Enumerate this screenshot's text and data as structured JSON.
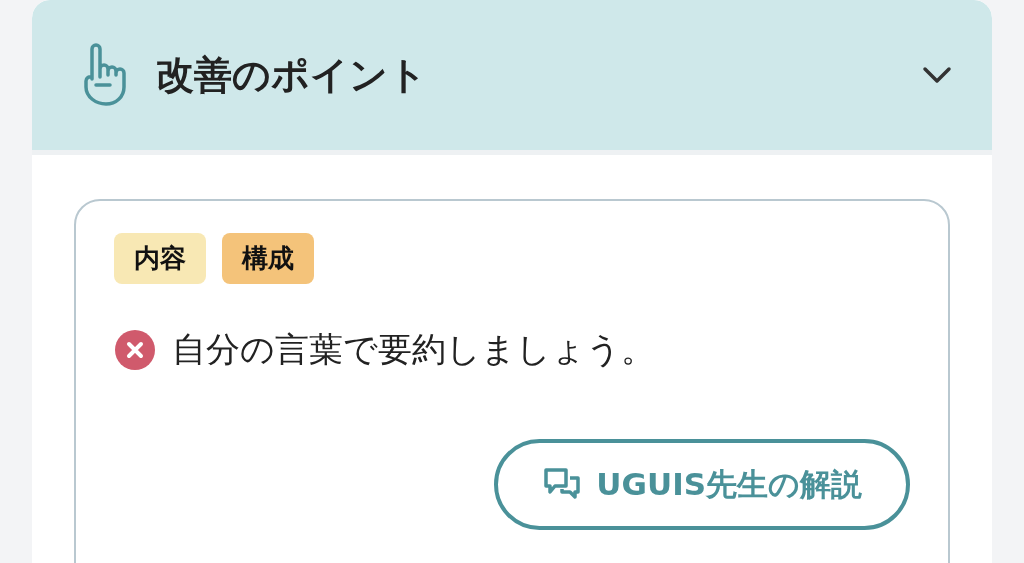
{
  "section": {
    "title": "改善のポイント"
  },
  "points": [
    {
      "tags": [
        {
          "label": "内容",
          "color": "#f8e8b4"
        },
        {
          "label": "構成",
          "color": "#f4c37a"
        }
      ],
      "kind": "error",
      "message": "自分の言葉で要約しましょう。",
      "action": "UGUIS先生の解説"
    }
  ]
}
